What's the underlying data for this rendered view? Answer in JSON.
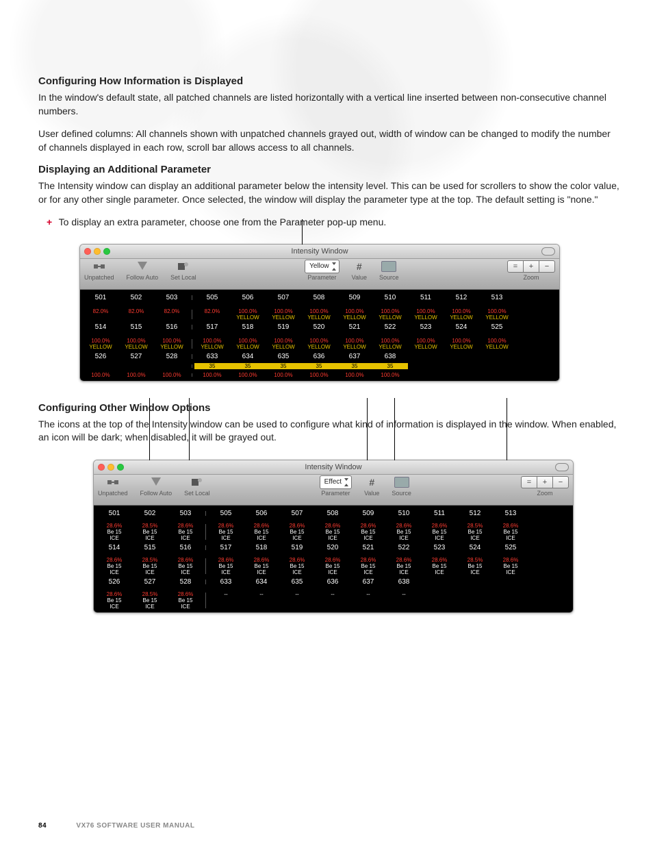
{
  "headings": {
    "h1": "Configuring How Information is Displayed",
    "h2": "Displaying an Additional Parameter",
    "h3": "Configuring Other Window Options"
  },
  "paragraphs": {
    "p1": "In the window's default state, all patched channels are listed horizontally with a vertical line inserted between non-consecutive channel numbers.",
    "p2": "User defined columns: All channels shown with unpatched channels grayed out, width of window can be changed to modify the number of channels displayed in each row, scroll bar allows access to all channels.",
    "p3": "The Intensity window can display an additional parameter below the intensity level. This can be used for scrollers to show the color value, or for any other single parameter. Once selected, the window will display the parameter type at the top. The default setting is \"none.\"",
    "p4": "The icons at the top of the Intensity window can be used to configure what kind of information is displayed in the window. When enabled, an icon will be dark; when disabled, it will be grayed out."
  },
  "bullet1": "To display an extra parameter, choose one from the Parameter pop-up menu.",
  "window": {
    "title": "Intensity Window",
    "tools": {
      "unpatched": "Unpatched",
      "follow": "Follow Auto",
      "setlocal": "Set Local",
      "parameter": "Parameter",
      "value": "Value",
      "source": "Source",
      "zoom": "Zoom"
    },
    "param_a": "Yellow",
    "param_b": "Effect",
    "zoom_eq": "=",
    "zoom_plus": "+",
    "zoom_minus": "−"
  },
  "gridA": {
    "row1_ch": [
      "501",
      "502",
      "503",
      "505",
      "506",
      "507",
      "508",
      "509",
      "510",
      "511",
      "512",
      "513"
    ],
    "row1_pct": [
      "82.0%",
      "82.0%",
      "82.0%",
      "82.0%",
      "100.0%",
      "100.0%",
      "100.0%",
      "100.0%",
      "100.0%",
      "100.0%",
      "100.0%",
      "100.0%"
    ],
    "row1_yel": [
      "",
      "",
      "",
      "",
      "YELLOW",
      "YELLOW",
      "YELLOW",
      "YELLOW",
      "YELLOW",
      "YELLOW",
      "YELLOW",
      "YELLOW"
    ],
    "row2_ch": [
      "514",
      "515",
      "516",
      "517",
      "518",
      "519",
      "520",
      "521",
      "522",
      "523",
      "524",
      "525"
    ],
    "row2_pct": [
      "100.0%",
      "100.0%",
      "100.0%",
      "100.0%",
      "100.0%",
      "100.0%",
      "100.0%",
      "100.0%",
      "100.0%",
      "100.0%",
      "100.0%",
      "100.0%"
    ],
    "row2_yel": [
      "YELLOW",
      "YELLOW",
      "YELLOW",
      "YELLOW",
      "YELLOW",
      "YELLOW",
      "YELLOW",
      "YELLOW",
      "YELLOW",
      "YELLOW",
      "YELLOW",
      "YELLOW"
    ],
    "row3_ch": [
      "526",
      "527",
      "528",
      "633",
      "634",
      "635",
      "636",
      "637",
      "638",
      "",
      "",
      ""
    ],
    "row3_hl": [
      "",
      "",
      "",
      "35",
      "35",
      "35",
      "35",
      "35",
      "35",
      "",
      "",
      ""
    ],
    "row3_pct": [
      "100.0%",
      "100.0%",
      "100.0%",
      "100.0%",
      "100.0%",
      "100.0%",
      "100.0%",
      "100.0%",
      "100.0%",
      "",
      "",
      ""
    ]
  },
  "gridB": {
    "r1_ch": [
      "501",
      "502",
      "503",
      "505",
      "506",
      "507",
      "508",
      "509",
      "510",
      "511",
      "512",
      "513"
    ],
    "r1_p": [
      "28.6%",
      "28.5%",
      "28.6%",
      "28.6%",
      "28.6%",
      "28.6%",
      "28.6%",
      "28.6%",
      "28.6%",
      "28.6%",
      "28.5%",
      "28.6%"
    ],
    "r1_b": [
      "Be 15",
      "Be 15",
      "Be 15",
      "Be 15",
      "Be 15",
      "Be 15",
      "Be 15",
      "Be 15",
      "Be 15",
      "Be 15",
      "Be 15",
      "Be 15"
    ],
    "r1_i": [
      "ICE",
      "ICE",
      "ICE",
      "ICE",
      "ICE",
      "ICE",
      "ICE",
      "ICE",
      "ICE",
      "ICE",
      "ICE",
      "ICE"
    ],
    "r2_ch": [
      "514",
      "515",
      "516",
      "517",
      "518",
      "519",
      "520",
      "521",
      "522",
      "523",
      "524",
      "525"
    ],
    "r2_p": [
      "28.6%",
      "28.5%",
      "28.6%",
      "28.6%",
      "28.6%",
      "28.6%",
      "28.6%",
      "28.6%",
      "28.6%",
      "28.6%",
      "28.5%",
      "28.6%"
    ],
    "r2_b": [
      "Be 15",
      "Be 15",
      "Be 15",
      "Be 15",
      "Be 15",
      "Be 15",
      "Be 15",
      "Be 15",
      "Be 15",
      "Be 15",
      "Be 15",
      "Be 15"
    ],
    "r2_i": [
      "ICE",
      "ICE",
      "ICE",
      "ICE",
      "ICE",
      "ICE",
      "ICE",
      "ICE",
      "ICE",
      "ICE",
      "ICE",
      "ICE"
    ],
    "r3_ch": [
      "526",
      "527",
      "528",
      "633",
      "634",
      "635",
      "636",
      "637",
      "638",
      "",
      "",
      ""
    ],
    "r3_p": [
      "28.6%",
      "28.5%",
      "28.6%",
      "--",
      "--",
      "--",
      "--",
      "--",
      "--",
      "",
      "",
      ""
    ],
    "r3_b": [
      "Be 15",
      "Be 15",
      "Be 15",
      "",
      "",
      "",
      "",
      "",
      "",
      "",
      "",
      ""
    ],
    "r3_i": [
      "ICE",
      "ICE",
      "ICE",
      "",
      "",
      "",
      "",
      "",
      "",
      "",
      "",
      ""
    ]
  },
  "footer": {
    "page": "84",
    "manual": "VX76 SOFTWARE USER MANUAL"
  }
}
